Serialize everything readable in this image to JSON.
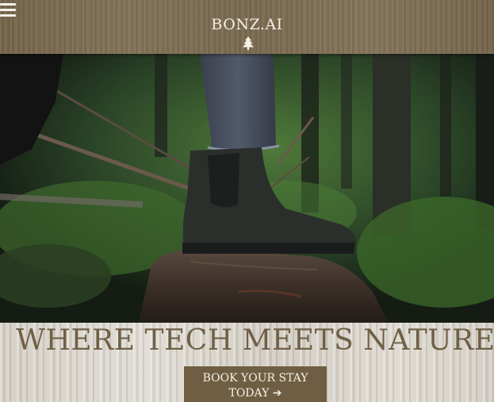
{
  "header": {
    "brand": "BONZ.AI",
    "menu_icon": "hamburger-menu-icon",
    "logo_icon": "pine-tree-icon"
  },
  "hero": {
    "image": "person-boot-standing-on-log-in-forest"
  },
  "tagline": "WHERE TECH MEETS NATURE",
  "cta": {
    "line1": "BOOK YOUR STAY",
    "line2": "TODAY",
    "arrow": "➔",
    "arrow_icon": "right-arrow-icon"
  },
  "colors": {
    "header_wood": "#7a6a50",
    "brand_text": "#f4efe4",
    "tagline_text": "#6f6046",
    "cta_background": "#6f5e43",
    "cta_text": "#f6f1e7",
    "band_background": "#d6d1c8"
  }
}
